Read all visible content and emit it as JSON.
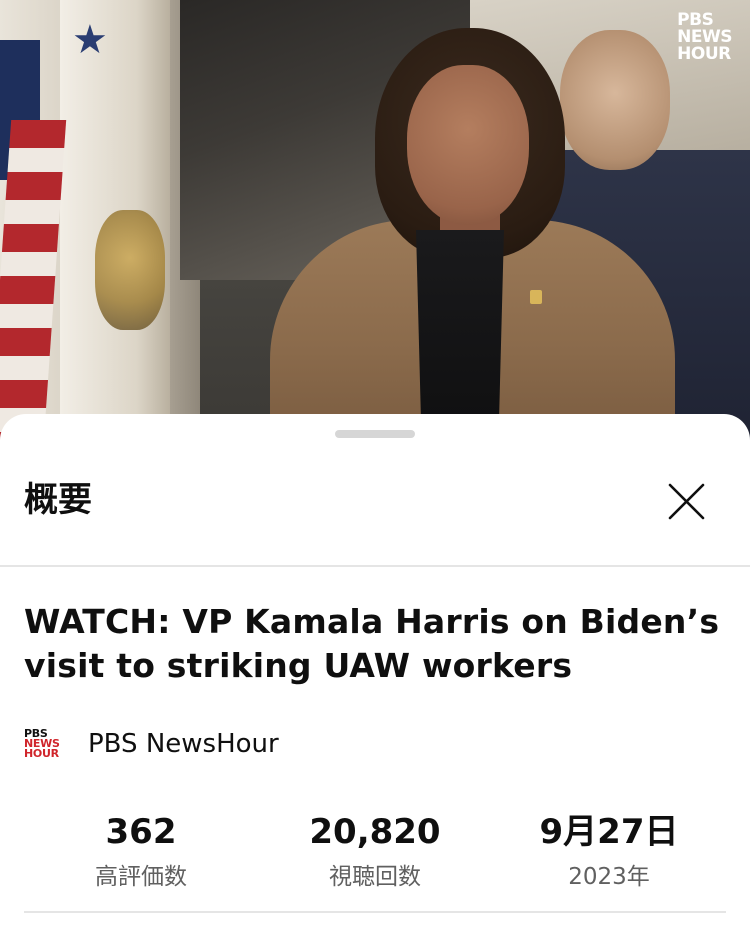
{
  "video": {
    "logo_line1": "PBS",
    "logo_line2": "NEWS",
    "logo_line3": "HOUR"
  },
  "sheet": {
    "title": "概要",
    "close_icon": "close-icon"
  },
  "description": {
    "video_title": "WATCH: VP Kamala Harris on Biden’s visit to striking UAW workers",
    "channel": {
      "logo_line1": "PBS",
      "logo_line2": "NEWS",
      "logo_line3": "HOUR",
      "name": "PBS NewsHour"
    },
    "stats": [
      {
        "value": "362",
        "label": "高評価数"
      },
      {
        "value": "20,820",
        "label": "視聴回数"
      },
      {
        "value": "9月27日",
        "label": "2023年"
      }
    ]
  }
}
